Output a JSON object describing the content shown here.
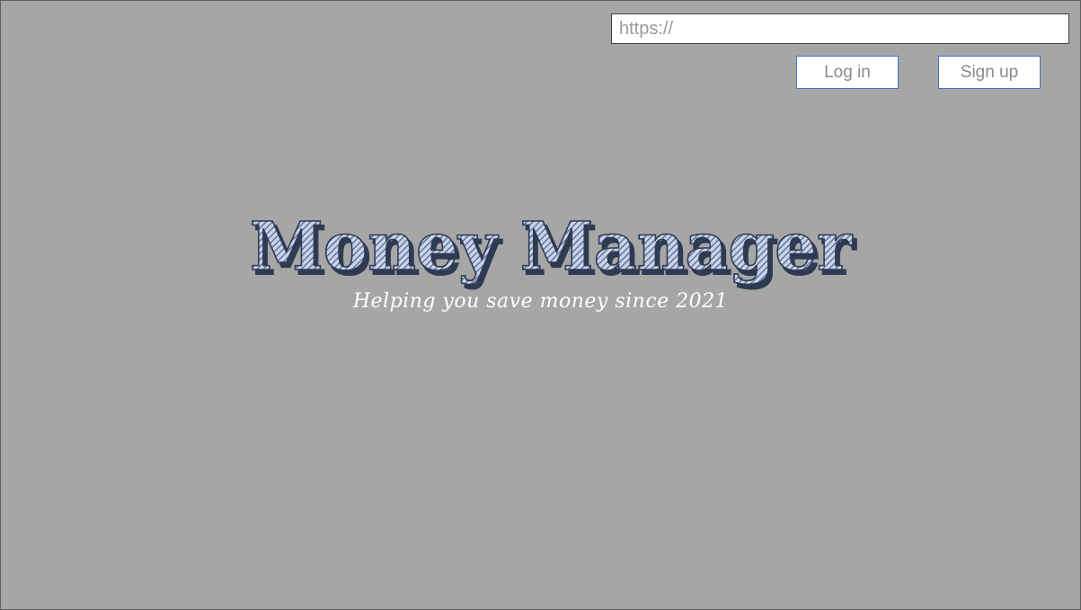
{
  "address_bar": {
    "placeholder": "https://",
    "value": ""
  },
  "auth": {
    "login_label": "Log in",
    "signup_label": "Sign up"
  },
  "hero": {
    "title": "Money Manager",
    "tagline": "Helping you save money since 2021"
  },
  "colors": {
    "background": "#a6a6a6",
    "title_fill": "#8ea3c8",
    "title_outline": "#2f3b52",
    "button_border": "#4472c4",
    "tagline": "#ffffff"
  }
}
